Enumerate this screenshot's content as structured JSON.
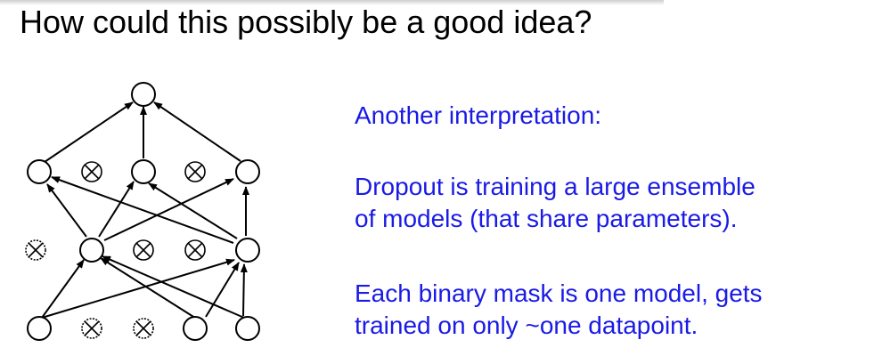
{
  "title": "How could this possibly be a good idea?",
  "interpretation_heading": "Another interpretation:",
  "paragraph1": {
    "line1": "Dropout is training a large ensemble",
    "line2": "of models (that share parameters)."
  },
  "paragraph2": {
    "line1": "Each binary mask is one model, gets",
    "line2": "trained on only ~one datapoint."
  },
  "colors": {
    "title": "#000000",
    "body_text": "#1a1ae6",
    "network_stroke": "#000000"
  },
  "network": {
    "node_icon": "circle-node",
    "dropped_icon": "crossed-circle-dropped-unit"
  }
}
